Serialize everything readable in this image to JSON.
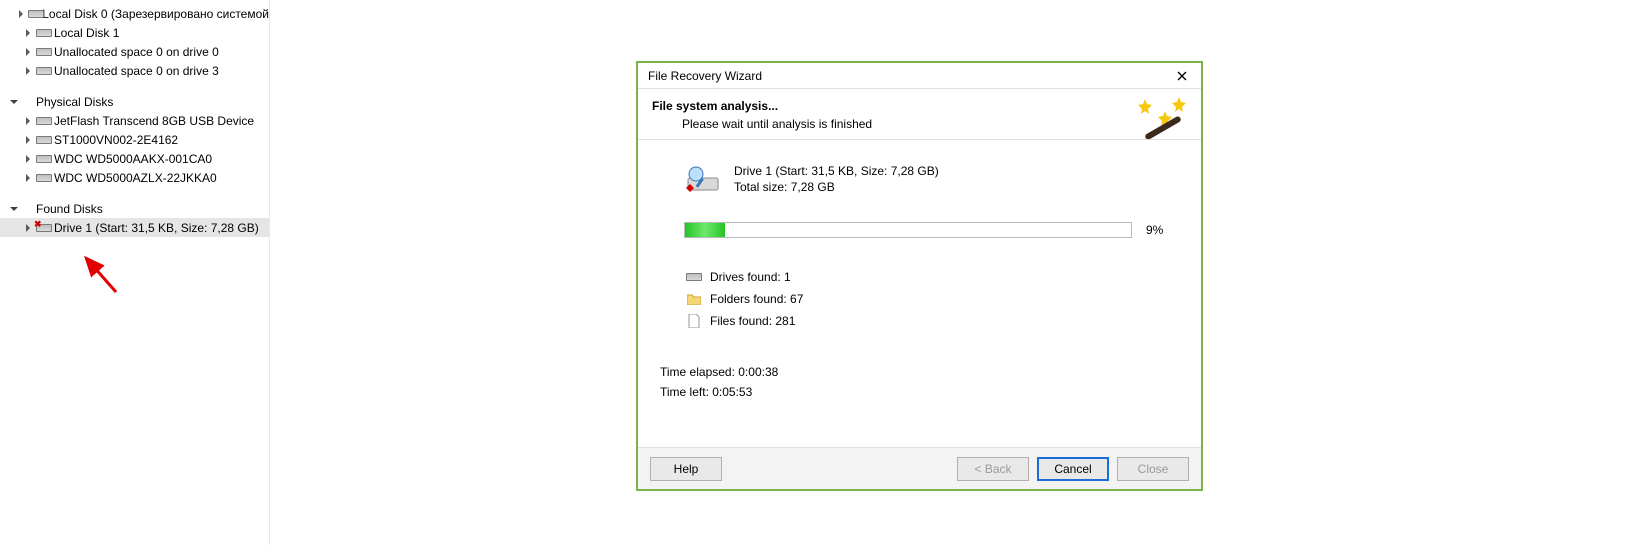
{
  "tree": {
    "items": [
      {
        "indent": 20,
        "arrow": "right",
        "icon": "disk",
        "label": "Local Disk 0 (Зарезервировано системой"
      },
      {
        "indent": 20,
        "arrow": "right",
        "icon": "disk",
        "label": "Local Disk 1"
      },
      {
        "indent": 20,
        "arrow": "right",
        "icon": "disk",
        "label": "Unallocated space 0 on drive 0"
      },
      {
        "indent": 20,
        "arrow": "right",
        "icon": "disk",
        "label": "Unallocated space 0 on drive 3"
      }
    ],
    "group_physical": {
      "label": "Physical Disks",
      "items": [
        {
          "label": "JetFlash Transcend 8GB USB Device"
        },
        {
          "label": "ST1000VN002-2E4162"
        },
        {
          "label": "WDC WD5000AAKX-001CA0"
        },
        {
          "label": "WDC WD5000AZLX-22JKKA0"
        }
      ]
    },
    "group_found": {
      "label": "Found Disks",
      "item": {
        "label": "Drive 1 (Start: 31,5 KB, Size: 7,28 GB)"
      }
    }
  },
  "wizard": {
    "title": "File Recovery Wizard",
    "heading": "File system analysis...",
    "subtitle": "Please wait until analysis is finished",
    "drive_name": "Drive 1 (Start: 31,5 KB, Size: 7,28 GB)",
    "total_size": "Total size: 7,28 GB",
    "progress_pct_text": "9%",
    "progress_pct_value": 9,
    "drives_found": "Drives found: 1",
    "folders_found": "Folders found: 67",
    "files_found": "Files found: 281",
    "time_elapsed": "Time elapsed: 0:00:38",
    "time_left": "Time left: 0:05:53",
    "buttons": {
      "help": "Help",
      "back": "< Back",
      "cancel": "Cancel",
      "close": "Close"
    }
  }
}
